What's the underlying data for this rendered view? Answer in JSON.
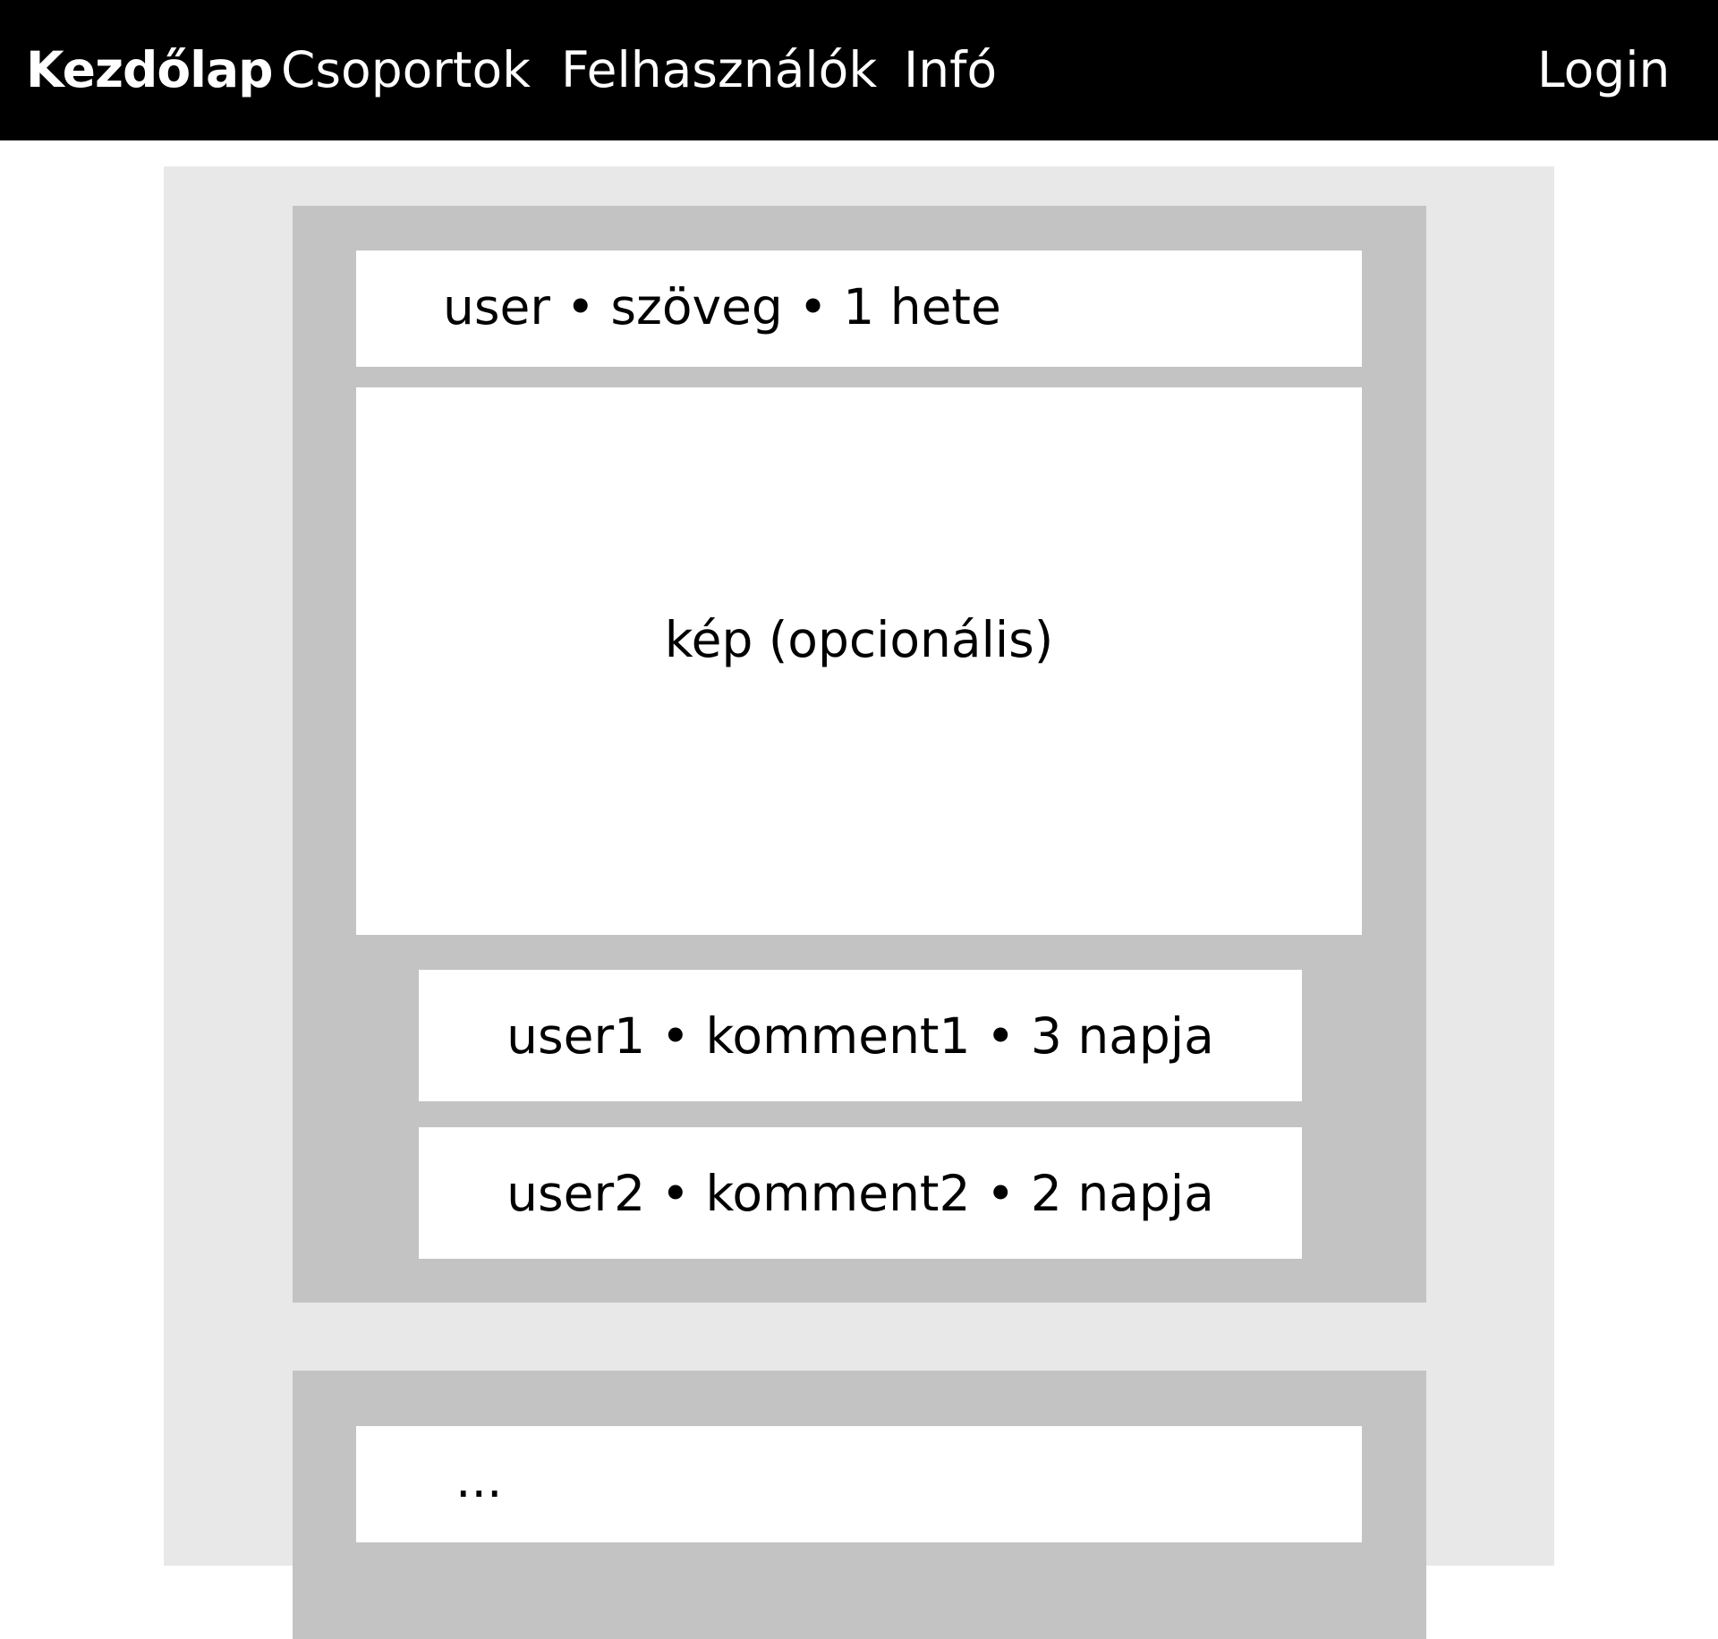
{
  "nav": {
    "home": "Kezdőlap",
    "groups": "Csoportok",
    "users": "Felhasználók",
    "info": "Infó",
    "login": "Login"
  },
  "posts": [
    {
      "header": "user • szöveg • 1 hete",
      "image_placeholder": "kép (opcionális)",
      "comments": [
        "user1 • komment1 • 3 napja",
        "user2 • komment2 • 2 napja"
      ]
    },
    {
      "header": "..."
    }
  ],
  "colors": {
    "topbar": "#000000",
    "feed_background": "#e8e8e8",
    "post_background": "#c3c3c3",
    "card_background": "#ffffff"
  }
}
